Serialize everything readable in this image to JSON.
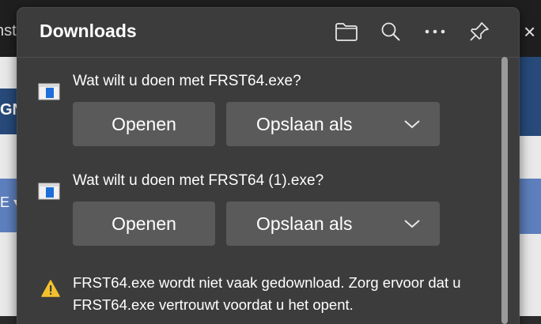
{
  "background": {
    "tab_text": "nst",
    "left_heading": "GN",
    "left_caret": "E ▾",
    "close_glyph": "×"
  },
  "downloads": {
    "title": "Downloads",
    "toolbar_icons": [
      "folder-icon",
      "search-icon",
      "more-icon",
      "pin-icon"
    ],
    "items": [
      {
        "question": "Wat wilt u doen met FRST64.exe?",
        "open_label": "Openen",
        "save_label": "Opslaan als"
      },
      {
        "question": "Wat wilt u doen met FRST64 (1).exe?",
        "open_label": "Openen",
        "save_label": "Opslaan als"
      }
    ],
    "warning": {
      "text": "FRST64.exe wordt niet vaak gedownload. Zorg ervoor dat u FRST64.exe vertrouwt voordat u het opent.",
      "color": "#f2c12e"
    }
  },
  "colors": {
    "flyout_bg": "#3c3c3c",
    "button_bg": "#5a5a5a",
    "accent_blue": "#1e6fd9"
  }
}
